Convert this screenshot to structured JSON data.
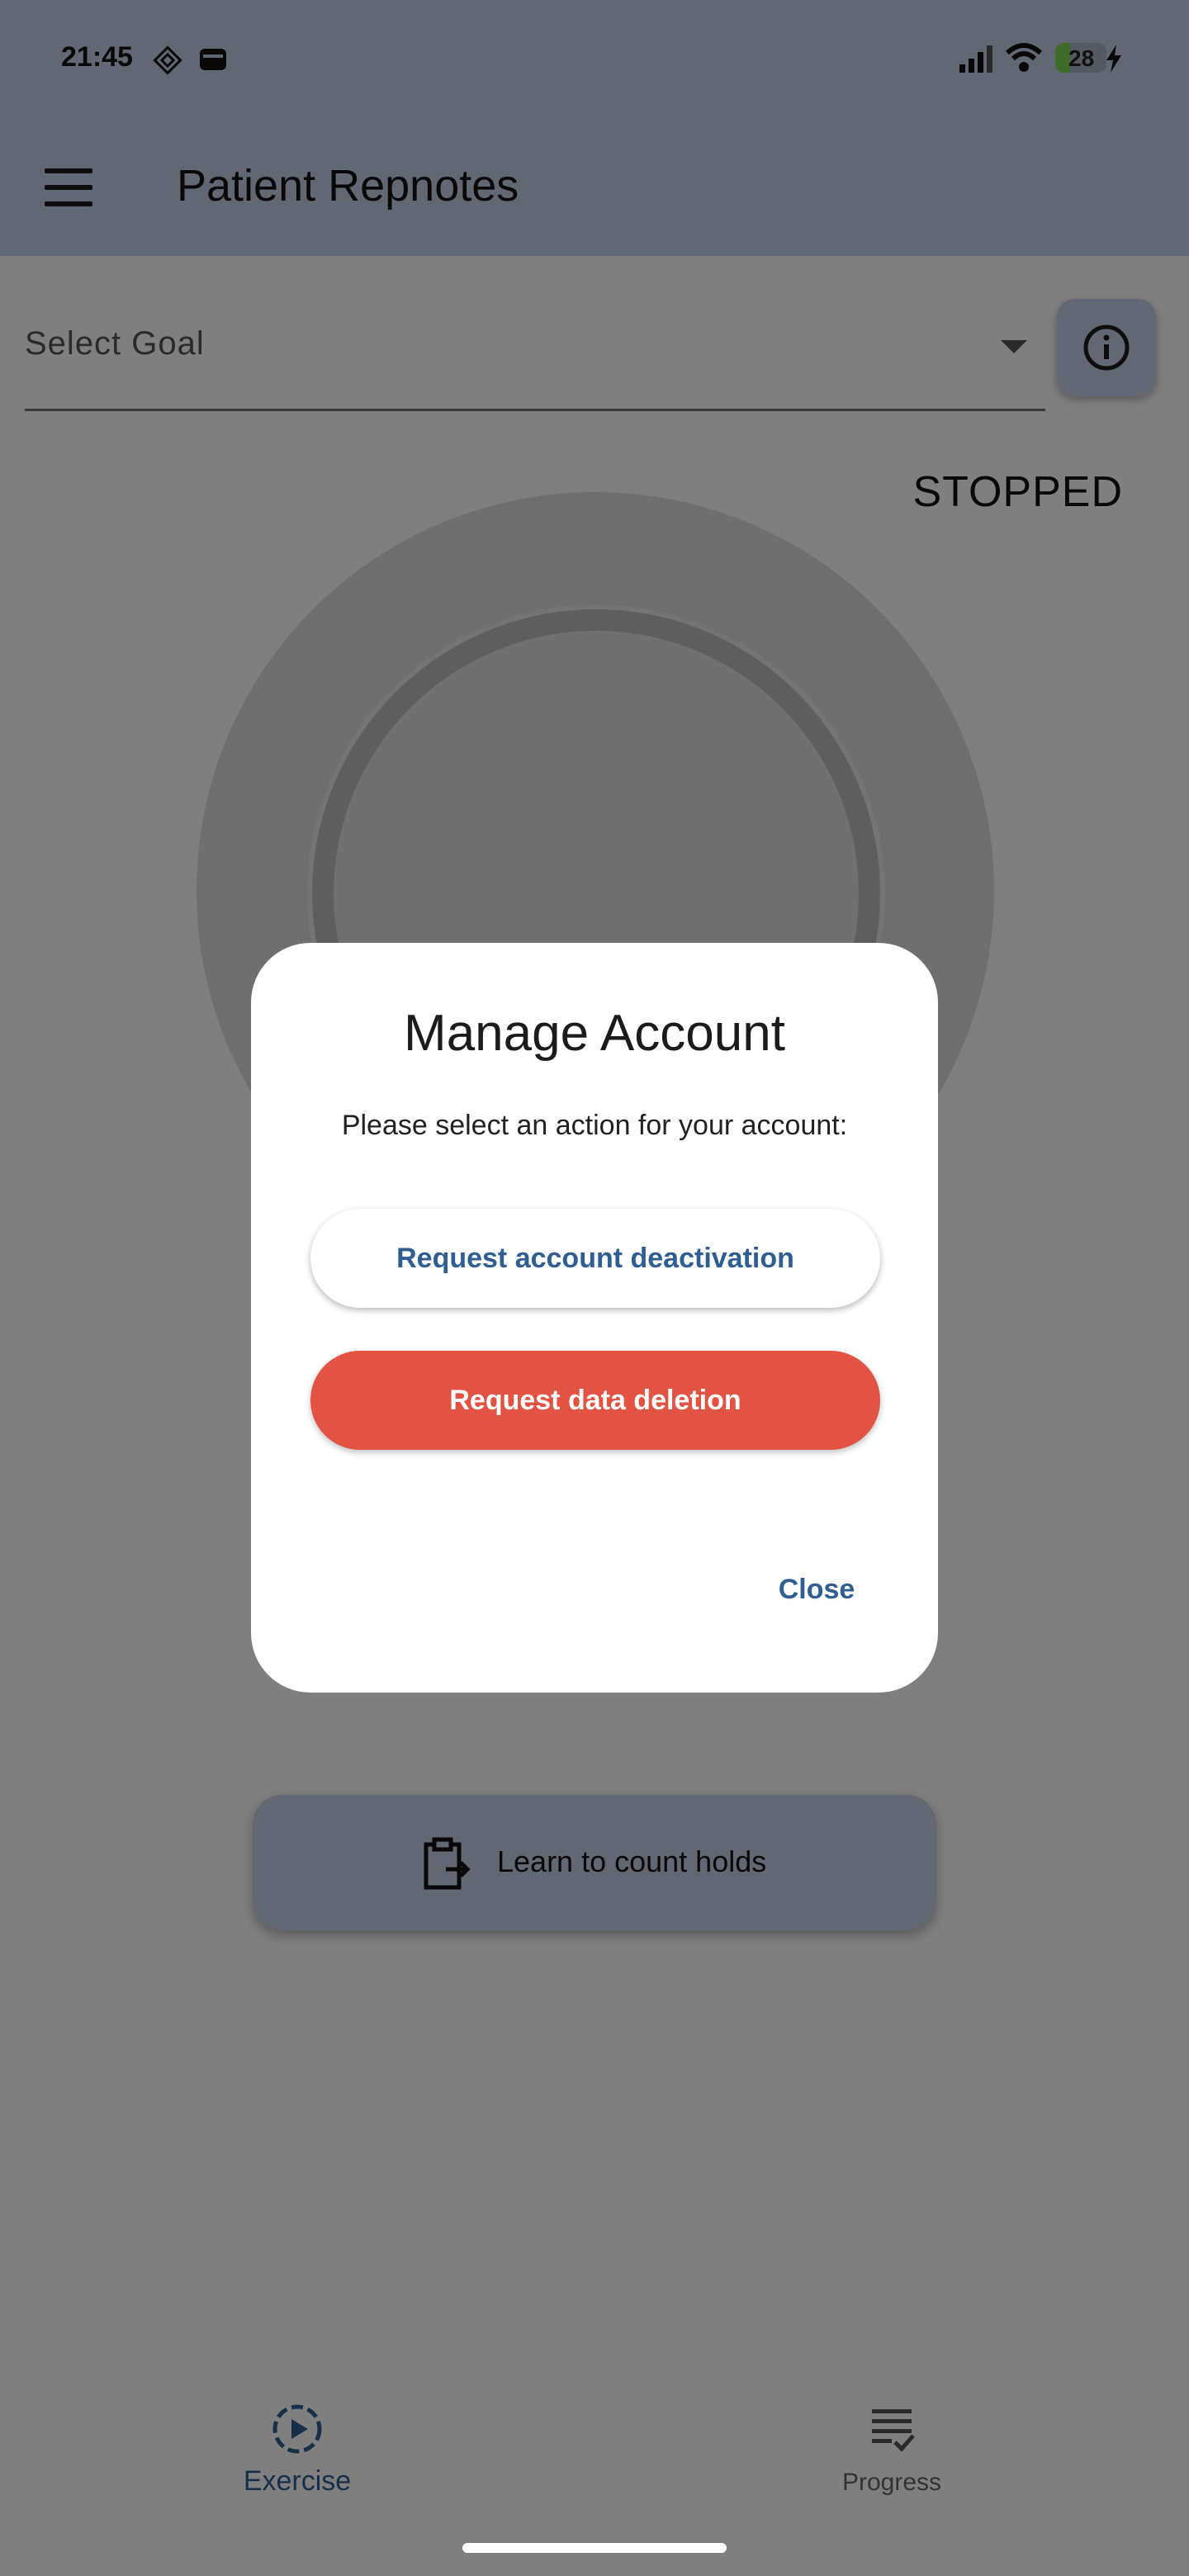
{
  "status_bar": {
    "time": "21:45",
    "battery": "28"
  },
  "app_bar": {
    "title": "Patient Repnotes"
  },
  "goal_select": {
    "label": "Select Goal"
  },
  "timer": {
    "state": "STOPPED"
  },
  "learn_button": {
    "label": "Learn to count holds"
  },
  "bottom_nav": {
    "items": [
      {
        "label": "Exercise",
        "icon": "play-circle-icon",
        "active": true
      },
      {
        "label": "Progress",
        "icon": "checklist-icon",
        "active": false
      }
    ]
  },
  "dialog": {
    "title": "Manage Account",
    "body": "Please select an action for your account:",
    "deactivate_label": "Request account deactivation",
    "delete_label": "Request data deletion",
    "close_label": "Close"
  },
  "colors": {
    "primary": "#2f5e93",
    "danger": "#e35343",
    "app_bar": "#c4d0e6"
  }
}
